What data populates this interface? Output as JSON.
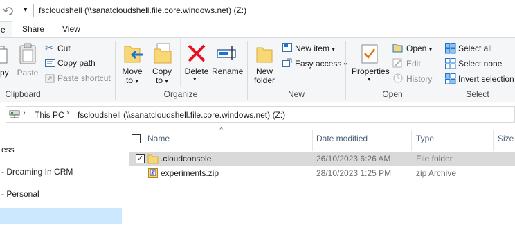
{
  "titlebar": {
    "title": "fscloudshell (\\\\sanatcloudshell.file.core.windows.net) (Z:)",
    "undo_icon": "undo-icon",
    "redo_icon": "redo-icon",
    "customize_icon": "chevron-down-icon"
  },
  "tabs": [
    {
      "label": "e"
    },
    {
      "label": "Share"
    },
    {
      "label": "View"
    }
  ],
  "ribbon": {
    "clipboard": {
      "label": "Clipboard",
      "copy_label": "py",
      "paste_label": "Paste",
      "cut_label": "Cut",
      "copy_path_label": "Copy path",
      "paste_shortcut_label": "Paste shortcut"
    },
    "organize": {
      "label": "Organize",
      "move_to_line1": "Move",
      "move_to_line2": "to",
      "copy_to_line1": "Copy",
      "copy_to_line2": "to",
      "delete_label": "Delete",
      "rename_label": "Rename"
    },
    "new": {
      "label": "New",
      "new_folder_line1": "New",
      "new_folder_line2": "folder",
      "new_item_label": "New item",
      "easy_access_label": "Easy access"
    },
    "open": {
      "label": "Open",
      "properties_label": "Properties",
      "open_label": "Open",
      "edit_label": "Edit",
      "history_label": "History"
    },
    "select": {
      "label": "Select",
      "select_all_label": "Select all",
      "select_none_label": "Select none",
      "invert_selection_label": "Invert selection"
    },
    "colors": {
      "delete_red": "#e81123",
      "folder_yellow": "#f8d775",
      "accent_blue": "#1e73d2"
    }
  },
  "address": {
    "this_pc": "This PC",
    "location": "fscloudshell (\\\\sanatcloudshell.file.core.windows.net) (Z:)"
  },
  "nav": {
    "items": [
      {
        "label": "ess"
      },
      {
        "label": "- Dreaming In CRM"
      },
      {
        "label": "- Personal"
      },
      {
        "label": ""
      }
    ]
  },
  "filelist": {
    "headers": {
      "name": "Name",
      "date": "Date modified",
      "type": "Type",
      "size": "Size"
    },
    "rows": [
      {
        "name": ".cloudconsole",
        "date": "26/10/2023 6:26 AM",
        "type": "File folder",
        "selected": true
      },
      {
        "name": "experiments.zip",
        "date": "28/10/2023 1:25 PM",
        "type": "zip Archive",
        "selected": false
      }
    ]
  }
}
